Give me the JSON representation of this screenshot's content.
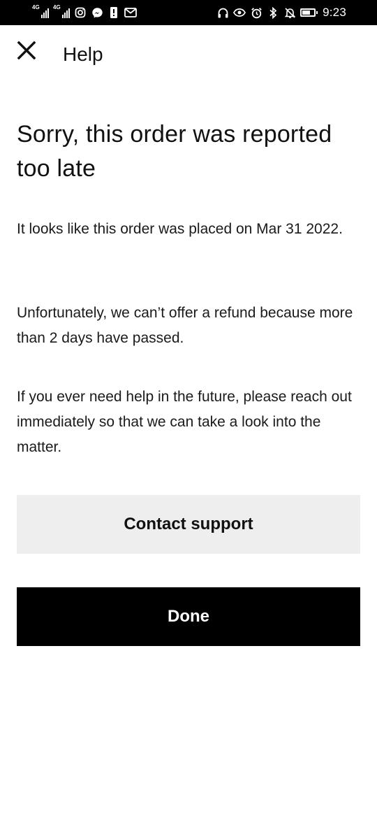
{
  "status_bar": {
    "time": "9:23",
    "signal_1_tag": "4G",
    "signal_2_tag": "4G",
    "left_icons": [
      "signal-icon",
      "signal-icon",
      "instagram-icon",
      "messenger-icon",
      "notification-icon",
      "gmail-icon"
    ],
    "right_icons": [
      "headphones-icon",
      "eye-icon",
      "alarm-icon",
      "bluetooth-icon",
      "mute-icon",
      "battery-icon"
    ]
  },
  "header": {
    "title": "Help",
    "close_icon": "close-icon"
  },
  "main": {
    "headline": "Sorry, this order was reported too late",
    "paragraphs": [
      "It looks like this order was placed on Mar 31 2022.",
      "Unfortunately, we can’t offer a refund because more than 2 days have passed.",
      "If you ever need help in the future, please reach out immediately so that we can take a look into the matter."
    ]
  },
  "actions": {
    "contact_support_label": "Contact support",
    "done_label": "Done"
  },
  "colors": {
    "status_bar_bg": "#000000",
    "page_bg": "#ffffff",
    "text": "#111111",
    "secondary_button_bg": "#eeeeee",
    "primary_button_bg": "#000000",
    "primary_button_text": "#ffffff"
  }
}
